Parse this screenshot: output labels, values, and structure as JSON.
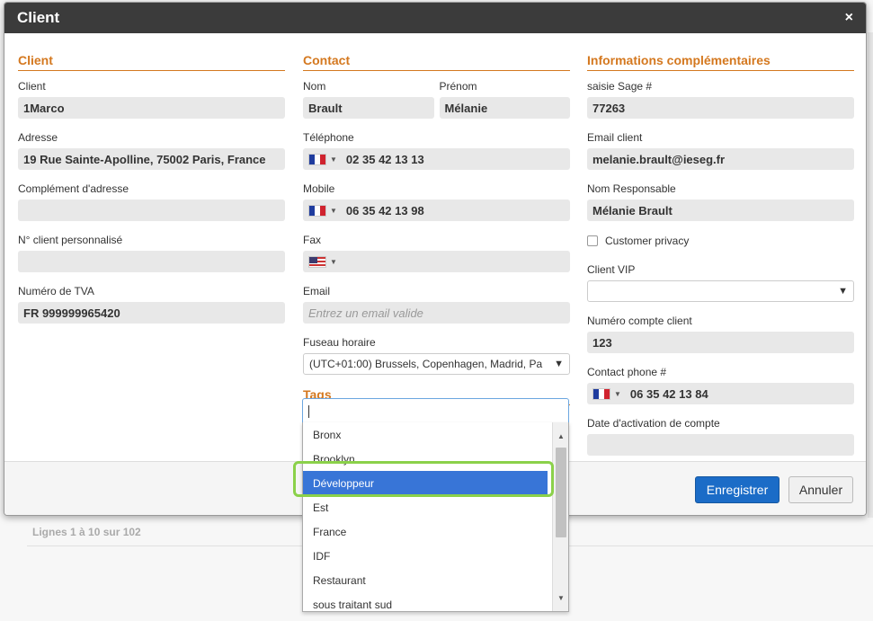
{
  "modal": {
    "title": "Client",
    "close": "×"
  },
  "col1": {
    "section": "Client",
    "client_label": "Client",
    "client_value": "1Marco",
    "adresse_label": "Adresse",
    "adresse_value": "19 Rue Sainte-Apolline, 75002 Paris, France",
    "complement_label": "Complément d'adresse",
    "complement_value": "",
    "num_client_label": "N° client personnalisé",
    "num_client_value": "",
    "tva_label": "Numéro de TVA",
    "tva_value": "FR 999999965420"
  },
  "col2": {
    "section": "Contact",
    "nom_label": "Nom",
    "nom_value": "Brault",
    "prenom_label": "Prénom",
    "prenom_value": "Mélanie",
    "tel_label": "Téléphone",
    "tel_value": "02 35 42 13 13",
    "mobile_label": "Mobile",
    "mobile_value": "06 35 42 13 98",
    "fax_label": "Fax",
    "fax_value": "",
    "email_label": "Email",
    "email_placeholder": "Entrez un email valide",
    "fuseau_label": "Fuseau horaire",
    "fuseau_value": "(UTC+01:00) Brussels, Copenhagen, Madrid, Pa",
    "tags_section": "Tags"
  },
  "col3": {
    "section": "Informations complémentaires",
    "sage_label": "saisie Sage #",
    "sage_value": "77263",
    "email_client_label": "Email client",
    "email_client_value": "melanie.brault@ieseg.fr",
    "responsable_label": "Nom Responsable",
    "responsable_value": "Mélanie Brault",
    "privacy_label": "Customer privacy",
    "vip_label": "Client VIP",
    "vip_value": "",
    "compte_label": "Numéro compte client",
    "compte_value": "123",
    "contact_phone_label": "Contact phone #",
    "contact_phone_value": "06 35 42 13 84",
    "activation_label": "Date d'activation de compte",
    "activation_value": ""
  },
  "tags": {
    "items": [
      "Bronx",
      "Brooklyn",
      "Développeur",
      "Est",
      "France",
      "IDF",
      "Restaurant",
      "sous traitant sud"
    ],
    "selected_index": 2
  },
  "footer": {
    "save": "Enregistrer",
    "cancel": "Annuler"
  },
  "background": {
    "pagination": "Lignes 1 à 10 sur 102"
  },
  "colors": {
    "accent": "#d4781f",
    "primary": "#1b6cc7",
    "header": "#3b3b3b",
    "selected": "#3875d7",
    "highlight": "#8bd14a"
  }
}
